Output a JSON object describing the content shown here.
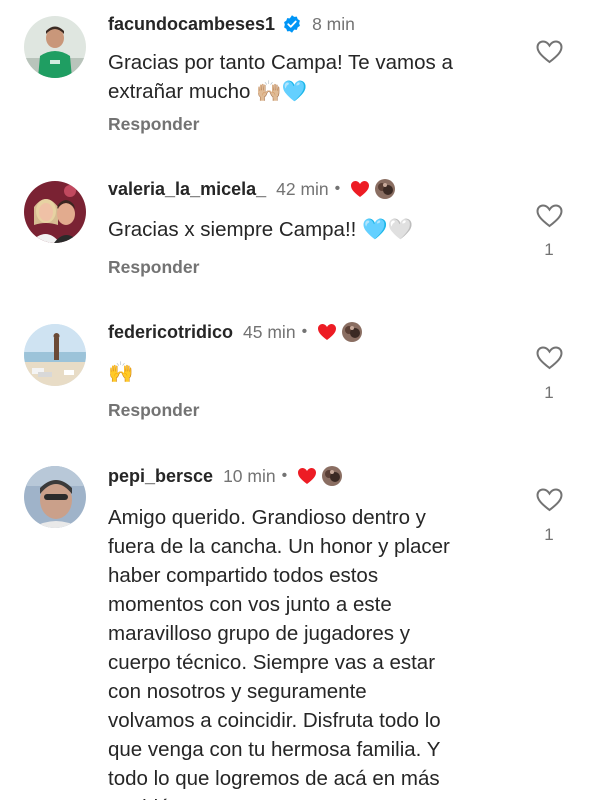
{
  "comments": [
    {
      "username": "facundocambeses1",
      "verified": true,
      "time": "8 min",
      "text": "Gracias por tanto Campa! Te vamos a\nextrañar mucho ",
      "emojis": "🙌🏼🩵",
      "reply_label": "Responder",
      "like_count": "",
      "creator_liked": false
    },
    {
      "username": "valeria_la_micela_",
      "verified": false,
      "time": "42 min",
      "separator": "•",
      "text": "Gracias x siempre Campa!! ",
      "emojis": "🩵🤍",
      "reply_label": "Responder",
      "like_count": "1",
      "creator_liked": true
    },
    {
      "username": "federicotridico",
      "verified": false,
      "time": "45 min",
      "separator": "•",
      "text": "",
      "emojis": "🙌",
      "reply_label": "Responder",
      "like_count": "1",
      "creator_liked": true
    },
    {
      "username": "pepi_bersce",
      "verified": false,
      "time": "10 min",
      "separator": "•",
      "text": "Amigo querido. Grandioso dentro y\nfuera de la cancha. Un honor y placer\nhaber compartido todos estos\nmomentos con vos junto a este\nmaravilloso grupo de jugadores y\ncuerpo técnico. Siempre vas a estar\ncon nosotros y seguramente\nvolvamos a coincidir. Disfruta todo lo\nque venga con tu hermosa familia. Y\ntodo lo que logremos de acá en más\ntambién va a ser tuyo.",
      "emojis": "",
      "reply_label": "",
      "like_count": "1",
      "creator_liked": true
    }
  ],
  "icons": {
    "verified": "verified-badge-icon",
    "like": "heart-outline-icon",
    "creator_like": "heart-filled-icon"
  },
  "colors": {
    "verified": "#0095f6",
    "creator_heart": "#ed1c24",
    "secondary_text": "#737373",
    "primary_text": "#262626"
  }
}
